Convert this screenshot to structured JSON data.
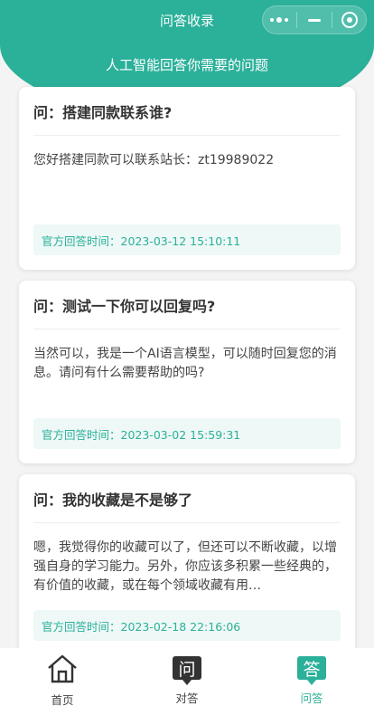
{
  "nav": {
    "title": "问答收录"
  },
  "header": {
    "subtitle": "人工智能回答你需要的问题"
  },
  "cards": [
    {
      "question": "问：搭建同款联系谁?",
      "answer": "您好搭建同款可以联系站长：zt19989022",
      "time": "官方回答时间：2023-03-12 15:10:11"
    },
    {
      "question": "问：测试一下你可以回复吗?",
      "answer": "当然可以，我是一个AI语言模型，可以随时回复您的消息。请问有什么需要帮助的吗?",
      "time": "官方回答时间：2023-03-02 15:59:31"
    },
    {
      "question": "问：我的收藏是不是够了",
      "answer": "嗯，我觉得你的收藏可以了，但还可以不断收藏，以增强自身的学习能力。另外，你应该多积累一些经典的，有价值的收藏，或在每个领域收藏有用…",
      "time": "官方回答时间：2023-02-18 22:16:06"
    }
  ],
  "tabbar": {
    "items": [
      {
        "label": "首页",
        "icon": "home-icon"
      },
      {
        "label": "对答",
        "icon_char": "问",
        "icon": "chat-question-icon"
      },
      {
        "label": "问答",
        "icon_char": "答",
        "icon": "answer-icon"
      }
    ],
    "active_index": 2
  },
  "colors": {
    "accent": "#2bb09a"
  }
}
